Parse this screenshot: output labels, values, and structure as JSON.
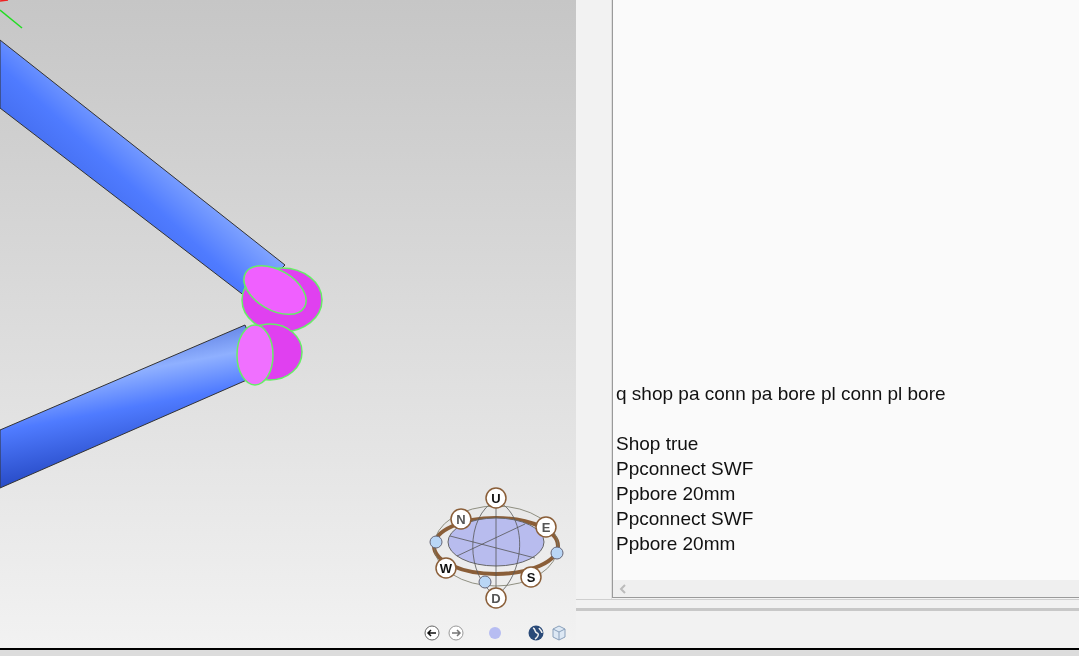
{
  "viewport": {
    "compass": {
      "up": "U",
      "north": "N",
      "east": "E",
      "west": "W",
      "south": "S",
      "down": "D"
    }
  },
  "output": {
    "command": "q shop pa conn pa bore pl conn pl bore",
    "results": [
      "Shop true",
      "Ppconnect SWF",
      "Ppbore 20mm",
      "Ppconnect SWF",
      "Ppbore 20mm"
    ]
  }
}
